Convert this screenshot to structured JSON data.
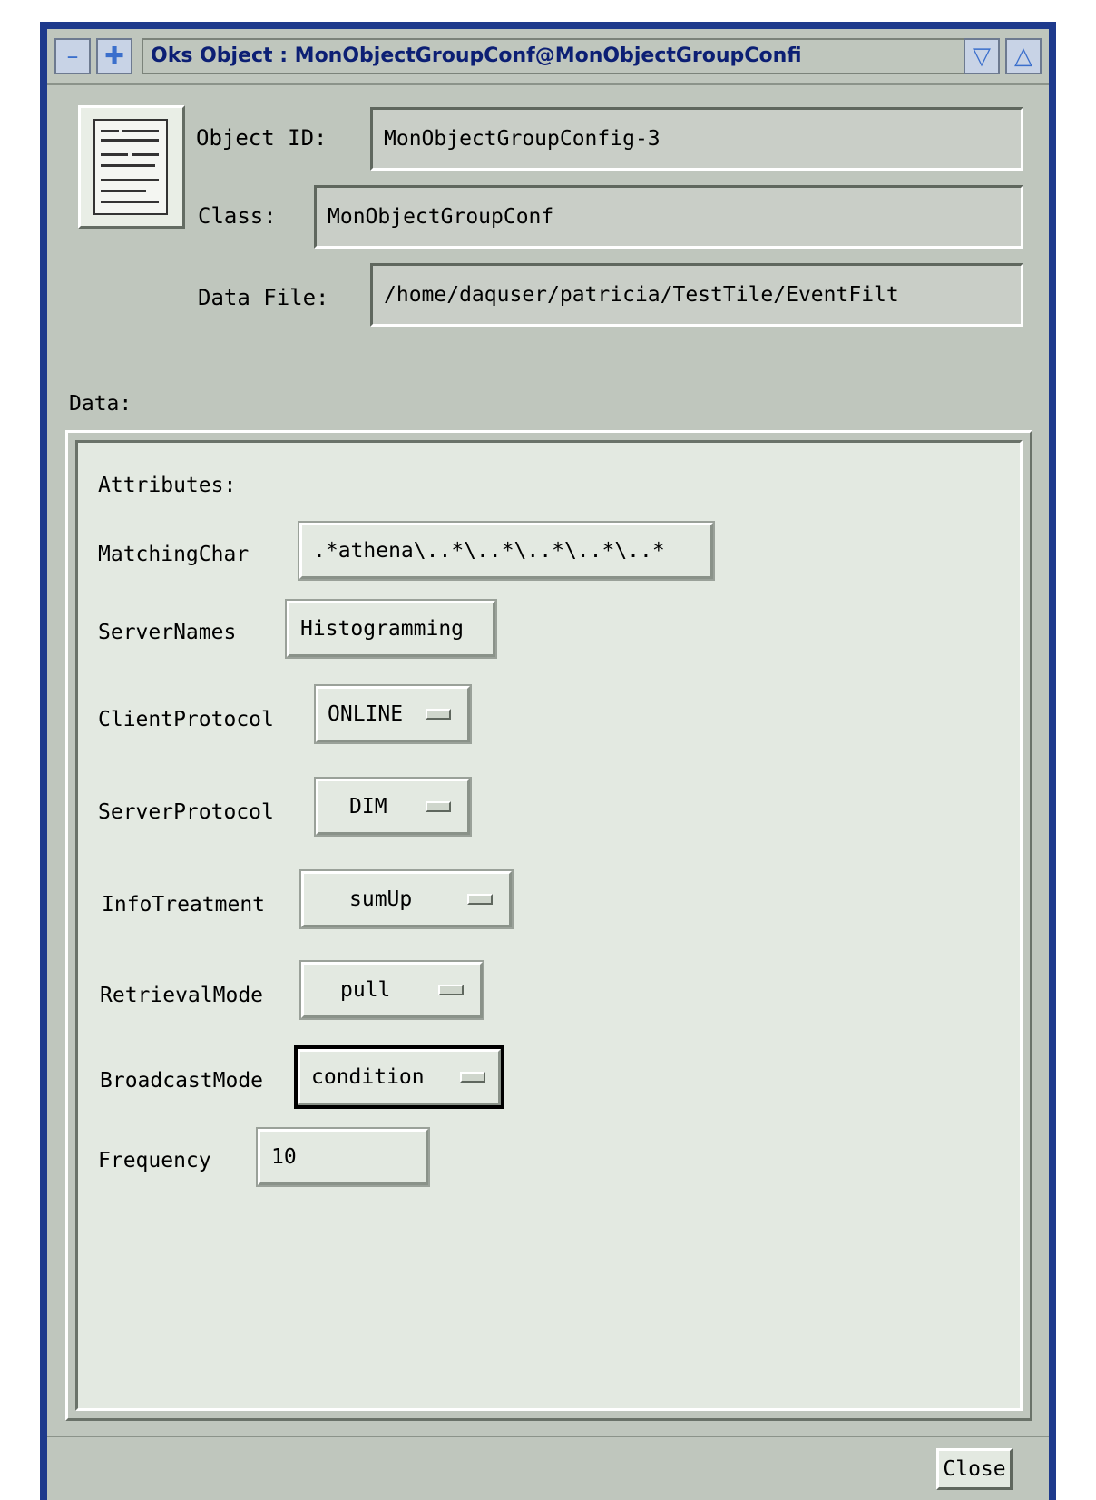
{
  "window": {
    "title": "Oks Object : MonObjectGroupConf@MonObjectGroupConfi",
    "controls": {
      "menu_icon": "window-menu-icon",
      "move_icon": "window-move-icon",
      "minimize_icon": "minimize-triangle-icon",
      "maximize_icon": "maximize-triangle-icon"
    },
    "accent_color": "#1e3a8c"
  },
  "header": {
    "object_id_label": "Object ID:",
    "object_id_value": "MonObjectGroupConfig-3",
    "class_label": "Class:",
    "class_value": "MonObjectGroupConf",
    "data_file_label": "Data File:",
    "data_file_value": "/home/daquser/patricia/TestTile/EventFilt"
  },
  "data_section": {
    "label": "Data:",
    "attributes_label": "Attributes:",
    "attributes": [
      {
        "label": "MatchingChar",
        "value": ".*athena\\..*\\..*\\..*\\..*\\..*",
        "kind": "text"
      },
      {
        "label": "ServerNames",
        "value": "Histogramming",
        "kind": "text"
      },
      {
        "label": "ClientProtocol",
        "value": "ONLINE",
        "kind": "option"
      },
      {
        "label": "ServerProtocol",
        "value": "DIM",
        "kind": "option"
      },
      {
        "label": "InfoTreatment",
        "value": "sumUp",
        "kind": "option"
      },
      {
        "label": "RetrievalMode",
        "value": "pull",
        "kind": "option"
      },
      {
        "label": "BroadcastMode",
        "value": "condition",
        "kind": "option",
        "focused": true
      },
      {
        "label": "Frequency",
        "value": "10",
        "kind": "text"
      }
    ]
  },
  "footer": {
    "close_label": "Close"
  }
}
